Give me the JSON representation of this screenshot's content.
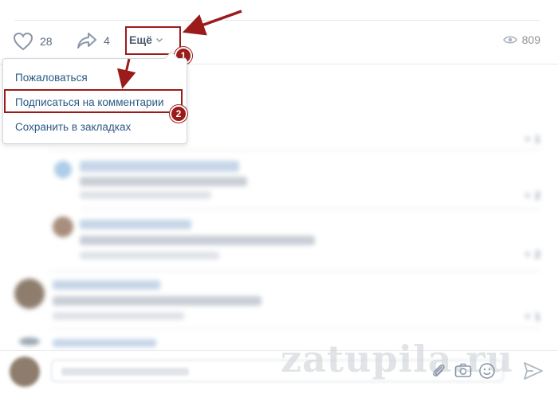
{
  "post_actions": {
    "likes": "28",
    "shares": "4",
    "more_label": "Ещё",
    "views": "809"
  },
  "more_menu": {
    "items": [
      {
        "label": "Пожаловаться"
      },
      {
        "label": "Подписаться на комментарии"
      },
      {
        "label": "Сохранить в закладках"
      }
    ]
  },
  "annotations": {
    "step1": "1",
    "step2": "2",
    "color": "#9b1b1b"
  },
  "comments": [
    {
      "like_count": "1"
    },
    {
      "like_count": "2"
    },
    {
      "like_count": "2"
    },
    {
      "like_count": "1"
    }
  ],
  "watermark": "zatupila.ru",
  "colors": {
    "link": "#2a5885",
    "muted": "#939393",
    "separator": "#e7e8ec"
  },
  "icons": [
    "heart-icon",
    "share-icon",
    "chevron-down-icon",
    "eye-icon",
    "paperclip-icon",
    "camera-icon",
    "smile-icon",
    "send-icon"
  ]
}
